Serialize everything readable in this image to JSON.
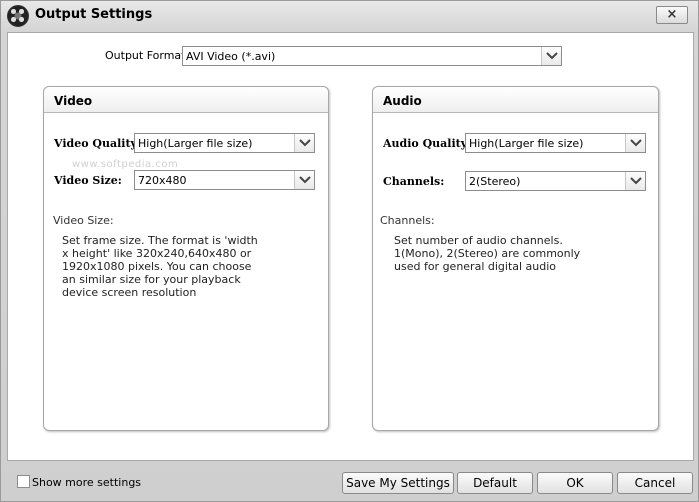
{
  "window": {
    "title": "Output Settings",
    "close_label": "×"
  },
  "output_format": {
    "label": "Output Format:",
    "value": "AVI Video (*.avi)"
  },
  "video": {
    "title": "Video",
    "quality_label": "Video Quality:",
    "quality_value": "High(Larger file size)",
    "size_label": "Video Size:",
    "size_value": "720x480",
    "desc_title": "Video Size:",
    "desc_text": "Set frame size. The format is 'width x height' like 320x240,640x480 or 1920x1080 pixels. You can choose an similar size for your playback device screen resolution"
  },
  "audio": {
    "title": "Audio",
    "quality_label": "Audio Quality:",
    "quality_value": "High(Larger file size)",
    "channels_label": "Channels:",
    "channels_value": "2(Stereo)",
    "desc_title": "Channels:",
    "desc_text": "Set number of audio channels. 1(Mono), 2(Stereo) are commonly used for general digital audio"
  },
  "watermark": "www.softpedia.com",
  "footer": {
    "show_more_label": "Show more settings",
    "save_label": "Save My Settings",
    "default_label": "Default",
    "ok_label": "OK",
    "cancel_label": "Cancel"
  }
}
